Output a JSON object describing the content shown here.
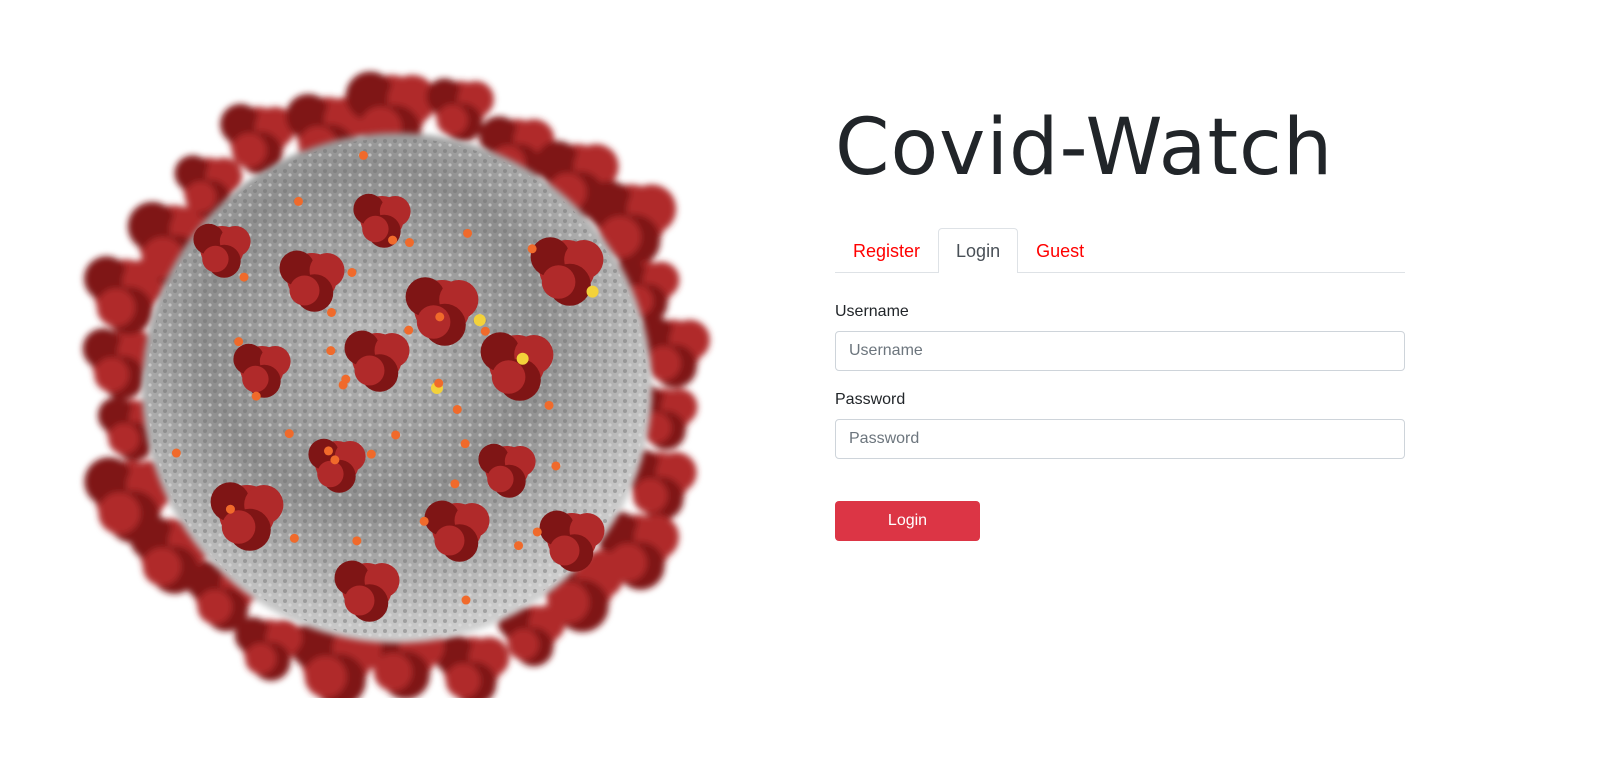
{
  "app": {
    "title": "Covid-Watch"
  },
  "hero": {
    "icon": "coronavirus-illustration",
    "colors": {
      "body": "#9a9a9a",
      "spike": "#b02a2a",
      "spike_dark": "#7f1515",
      "dot_orange": "#f06a2b",
      "dot_yellow": "#f3d23a"
    }
  },
  "tabs": [
    {
      "label": "Register",
      "active": false
    },
    {
      "label": "Login",
      "active": true
    },
    {
      "label": "Guest",
      "active": false
    }
  ],
  "form": {
    "username_label": "Username",
    "username_placeholder": "Username",
    "username_value": "",
    "password_label": "Password",
    "password_placeholder": "Password",
    "password_value": "",
    "submit_label": "Login"
  },
  "colors": {
    "tab_link": "#ff0000",
    "button": "#dc3545",
    "text": "#212529",
    "border": "#dee2e6"
  }
}
